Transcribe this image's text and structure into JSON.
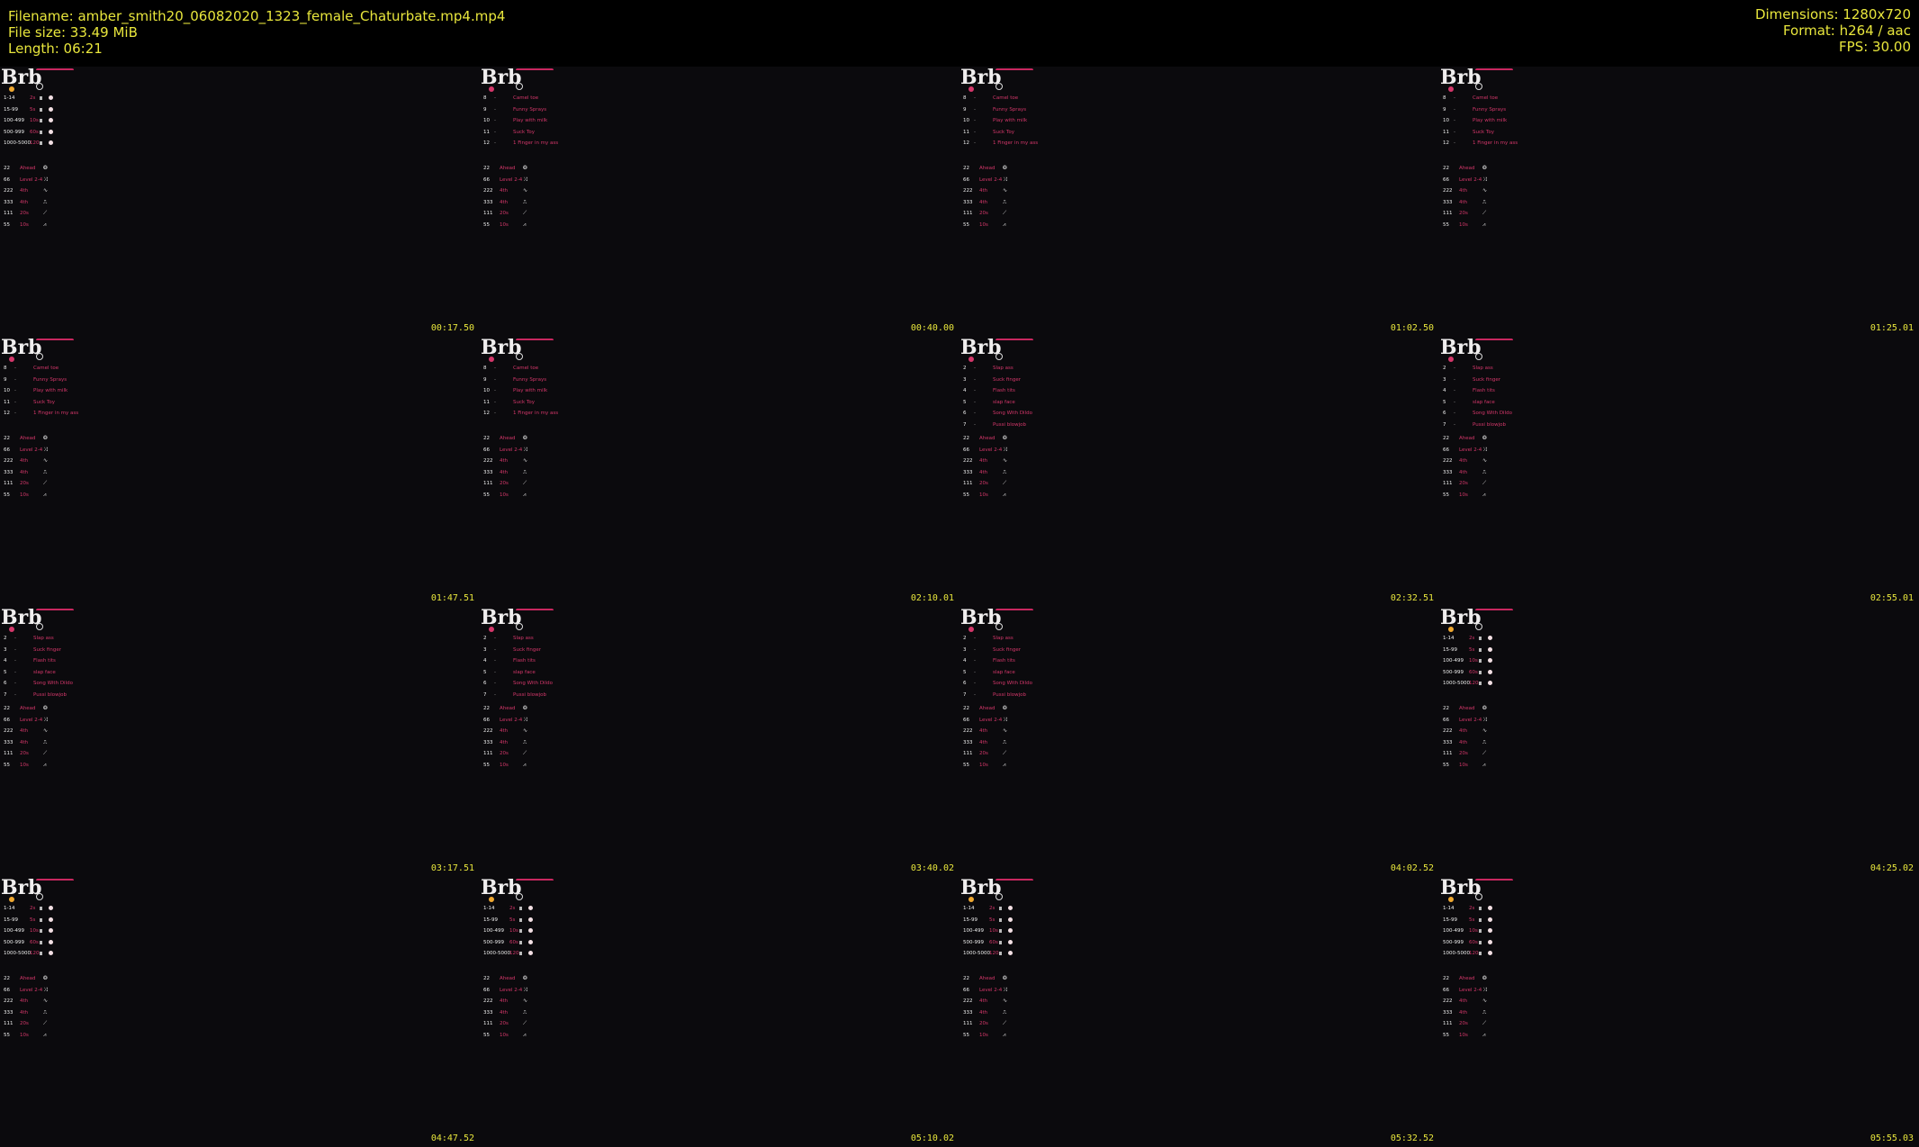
{
  "header": {
    "filename": "Filename: amber_smith20_06082020_1323_female_Chaturbate.mp4.mp4",
    "filesize": "File size: 33.49 MiB",
    "length": "Length: 06:21",
    "dimensions": "Dimensions: 1280x720",
    "format": "Format: h264 / aac",
    "fps": "FPS: 30.00"
  },
  "overlay": {
    "title": "Brb",
    "tip_table": [
      {
        "range": "1-14",
        "amount": "2s"
      },
      {
        "range": "15-99",
        "amount": "5s"
      },
      {
        "range": "100-499",
        "amount": "10s"
      },
      {
        "range": "500-999",
        "amount": "60s"
      },
      {
        "range": "1000-5000",
        "amount": "120s"
      }
    ],
    "menu_a": [
      {
        "num": "8",
        "label": "Camel toe"
      },
      {
        "num": "9",
        "label": "Funny Sprays"
      },
      {
        "num": "10",
        "label": "Play with milk"
      },
      {
        "num": "11",
        "label": "Suck Toy"
      },
      {
        "num": "12",
        "label": "1 Finger in my ass"
      }
    ],
    "menu_b": [
      {
        "num": "2",
        "label": "Slap ass"
      },
      {
        "num": "3",
        "label": "Suck finger"
      },
      {
        "num": "4",
        "label": "Flash tits"
      },
      {
        "num": "5",
        "label": "slap face"
      },
      {
        "num": "6",
        "label": "Song With Dildo"
      },
      {
        "num": "7",
        "label": "Pussi blowjob"
      }
    ],
    "patterns": [
      {
        "num": "22",
        "label": "Ahead"
      },
      {
        "num": "66",
        "label": "Level 2-4"
      },
      {
        "num": "222",
        "label": "4th"
      },
      {
        "num": "333",
        "label": "4th"
      },
      {
        "num": "111",
        "label": "20s"
      },
      {
        "num": "55",
        "label": "10s"
      }
    ]
  },
  "colors": {
    "timestamp": "#e8e63c",
    "accent": "#d4376a",
    "dot": "#f0a830"
  },
  "thumbnails": [
    {
      "timestamp": "00:17.50",
      "variant": "tips"
    },
    {
      "timestamp": "00:40.00",
      "variant": "a"
    },
    {
      "timestamp": "01:02.50",
      "variant": "a"
    },
    {
      "timestamp": "01:25.01",
      "variant": "a"
    },
    {
      "timestamp": "01:47.51",
      "variant": "a"
    },
    {
      "timestamp": "02:10.01",
      "variant": "a"
    },
    {
      "timestamp": "02:32.51",
      "variant": "b"
    },
    {
      "timestamp": "02:55.01",
      "variant": "b"
    },
    {
      "timestamp": "03:17.51",
      "variant": "b"
    },
    {
      "timestamp": "03:40.02",
      "variant": "b"
    },
    {
      "timestamp": "04:02.52",
      "variant": "b"
    },
    {
      "timestamp": "04:25.02",
      "variant": "tips"
    },
    {
      "timestamp": "04:47.52",
      "variant": "tips"
    },
    {
      "timestamp": "05:10.02",
      "variant": "tips"
    },
    {
      "timestamp": "05:32.52",
      "variant": "tips"
    },
    {
      "timestamp": "05:55.03",
      "variant": "tips"
    }
  ]
}
